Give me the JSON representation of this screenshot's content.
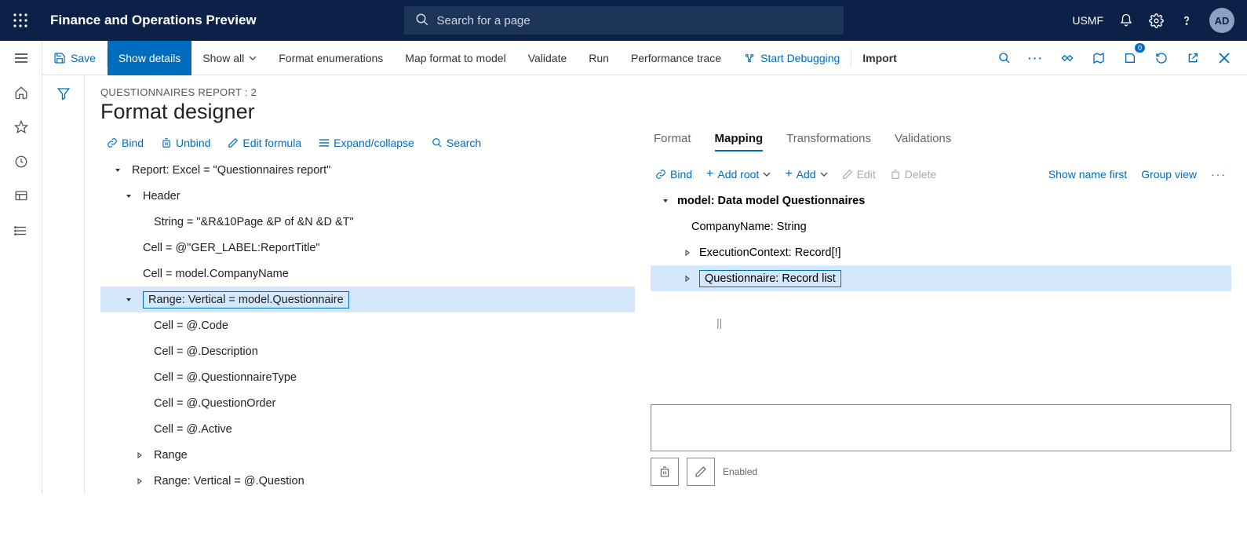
{
  "topbar": {
    "title": "Finance and Operations Preview",
    "search_placeholder": "Search for a page",
    "company": "USMF",
    "avatar": "AD"
  },
  "cmdbar": {
    "save": "Save",
    "show_details": "Show details",
    "show_all": "Show all",
    "format_enum": "Format enumerations",
    "map_format": "Map format to model",
    "validate": "Validate",
    "run": "Run",
    "perf_trace": "Performance trace",
    "start_debug": "Start Debugging",
    "import": "Import",
    "badge": "0"
  },
  "page": {
    "crumb": "QUESTIONNAIRES REPORT : 2",
    "title": "Format designer"
  },
  "left_toolbar": {
    "bind": "Bind",
    "unbind": "Unbind",
    "edit_formula": "Edit formula",
    "expand": "Expand/collapse",
    "search": "Search"
  },
  "format_tree": [
    {
      "indent": 0,
      "arrow": "down",
      "text": "Report: Excel = \"Questionnaires report\""
    },
    {
      "indent": 1,
      "arrow": "down",
      "text": "Header<Any>"
    },
    {
      "indent": 2,
      "arrow": "",
      "text": "String = \"&R&10Page &P of &N &D &T\""
    },
    {
      "indent": 1,
      "arrow": "",
      "text": "Cell<ReportTitle> = @\"GER_LABEL:ReportTitle\""
    },
    {
      "indent": 1,
      "arrow": "",
      "text": "Cell<CompanyName> = model.CompanyName"
    },
    {
      "indent": 1,
      "arrow": "down",
      "text": "Range<Questionnaire>: Vertical = model.Questionnaire",
      "selected": true
    },
    {
      "indent": 2,
      "arrow": "",
      "text": "Cell<Code> = @.Code"
    },
    {
      "indent": 2,
      "arrow": "",
      "text": "Cell<Description> = @.Description"
    },
    {
      "indent": 2,
      "arrow": "",
      "text": "Cell<QuestionnaireType> = @.QuestionnaireType"
    },
    {
      "indent": 2,
      "arrow": "",
      "text": "Cell<QuestionOrder> = @.QuestionOrder"
    },
    {
      "indent": 2,
      "arrow": "",
      "text": "Cell<Active> = @.Active"
    },
    {
      "indent": 2,
      "arrow": "right",
      "text": "Range<ResultsGroup>"
    },
    {
      "indent": 2,
      "arrow": "right",
      "text": "Range<Question>: Vertical = @.Question"
    }
  ],
  "tabs": {
    "format": "Format",
    "mapping": "Mapping",
    "transformations": "Transformations",
    "validations": "Validations"
  },
  "right_toolbar": {
    "bind": "Bind",
    "add_root": "Add root",
    "add": "Add",
    "edit": "Edit",
    "delete": "Delete",
    "show_name": "Show name first",
    "group_view": "Group view"
  },
  "model_tree": [
    {
      "indent": 0,
      "arrow": "down",
      "text": "model: Data model Questionnaires",
      "bold": true
    },
    {
      "indent": 1,
      "arrow": "",
      "text": "CompanyName: String"
    },
    {
      "indent": 1,
      "arrow": "right",
      "text": "ExecutionContext: Record[!]"
    },
    {
      "indent": 1,
      "arrow": "right",
      "text": "Questionnaire: Record list",
      "selected": true
    }
  ],
  "bottom": {
    "enabled_label": "Enabled"
  }
}
